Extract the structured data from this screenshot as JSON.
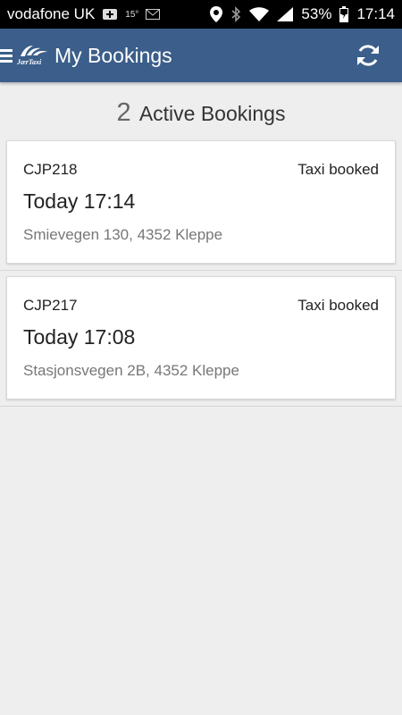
{
  "status_bar": {
    "carrier": "vodafone UK",
    "temp": "15°",
    "battery": "53%",
    "time": "17:14"
  },
  "app_bar": {
    "logo_text": "JærTaxi",
    "title": "My Bookings"
  },
  "summary": {
    "count": "2",
    "label": "Active Bookings"
  },
  "bookings": [
    {
      "ref": "CJP218",
      "status": "Taxi booked",
      "time": "Today 17:14",
      "address": "Smievegen 130, 4352 Kleppe"
    },
    {
      "ref": "CJP217",
      "status": "Taxi booked",
      "time": "Today 17:08",
      "address": "Stasjonsvegen 2B, 4352 Kleppe"
    }
  ],
  "colors": {
    "app_bar": "#3b5e8a",
    "background": "#eeeeee"
  }
}
